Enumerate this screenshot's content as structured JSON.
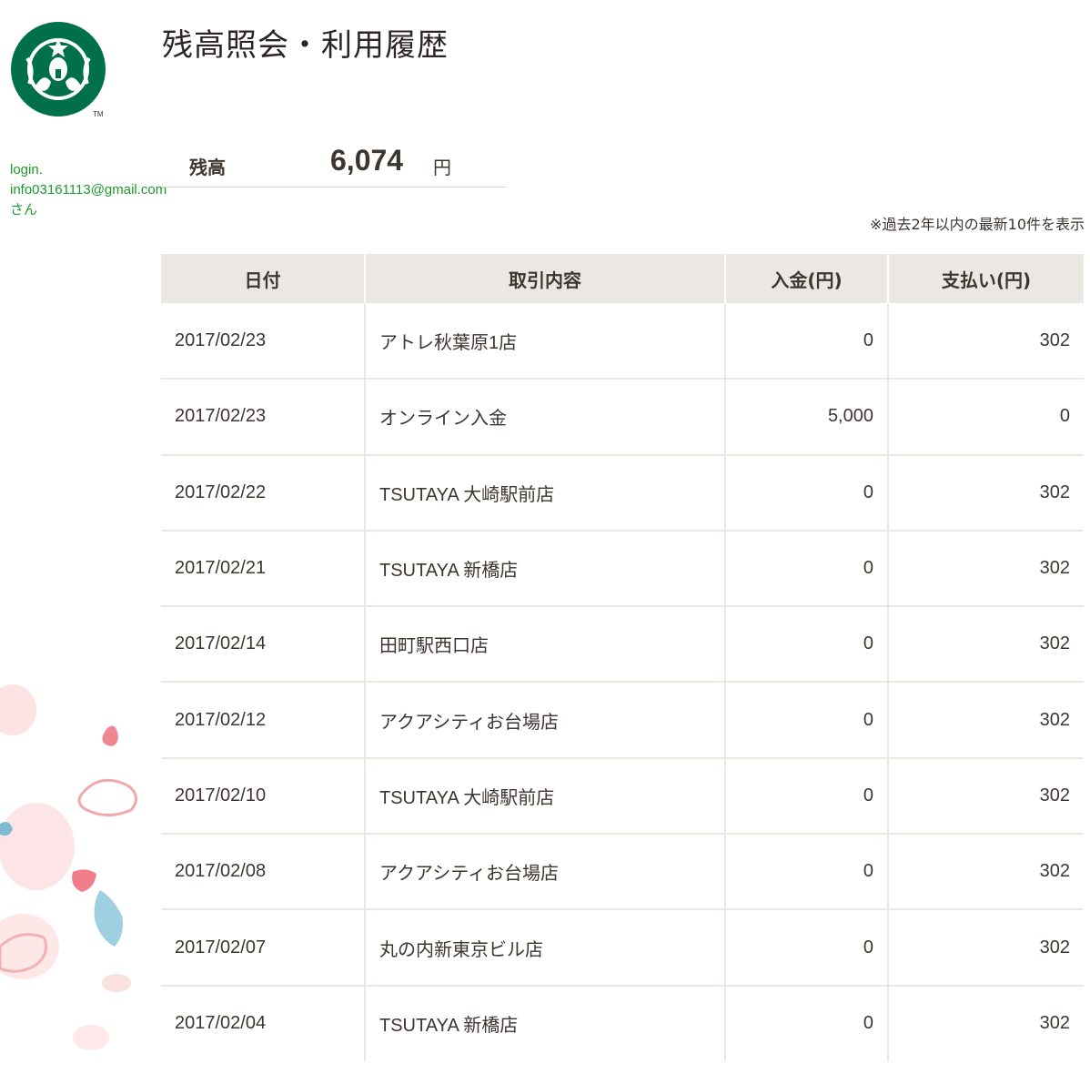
{
  "header": {
    "title": "残高照会・利用履歴"
  },
  "brand": {
    "accent_color": "#00704a",
    "logo_icon": "starbucks-siren-logo-icon"
  },
  "user": {
    "login_label": "login.",
    "email": "info03161113@gmail.com",
    "suffix": "さん"
  },
  "balance": {
    "label": "残高",
    "value": "6,074",
    "unit": "円"
  },
  "note": "※過去2年以内の最新10件を表示",
  "table": {
    "columns": [
      "日付",
      "取引内容",
      "入金(円)",
      "支払い(円)"
    ],
    "rows": [
      {
        "date": "2017/02/23",
        "desc": "アトレ秋葉原1店",
        "deposit": "0",
        "payment": "302"
      },
      {
        "date": "2017/02/23",
        "desc": "オンライン入金",
        "deposit": "5,000",
        "payment": "0"
      },
      {
        "date": "2017/02/22",
        "desc": "TSUTAYA 大崎駅前店",
        "deposit": "0",
        "payment": "302"
      },
      {
        "date": "2017/02/21",
        "desc": "TSUTAYA 新橋店",
        "deposit": "0",
        "payment": "302"
      },
      {
        "date": "2017/02/14",
        "desc": "田町駅西口店",
        "deposit": "0",
        "payment": "302"
      },
      {
        "date": "2017/02/12",
        "desc": "アクアシティお台場店",
        "deposit": "0",
        "payment": "302"
      },
      {
        "date": "2017/02/10",
        "desc": "TSUTAYA 大崎駅前店",
        "deposit": "0",
        "payment": "302"
      },
      {
        "date": "2017/02/08",
        "desc": "アクアシティお台場店",
        "deposit": "0",
        "payment": "302"
      },
      {
        "date": "2017/02/07",
        "desc": "丸の内新東京ビル店",
        "deposit": "0",
        "payment": "302"
      },
      {
        "date": "2017/02/04",
        "desc": "TSUTAYA 新橋店",
        "deposit": "0",
        "payment": "302"
      }
    ]
  }
}
